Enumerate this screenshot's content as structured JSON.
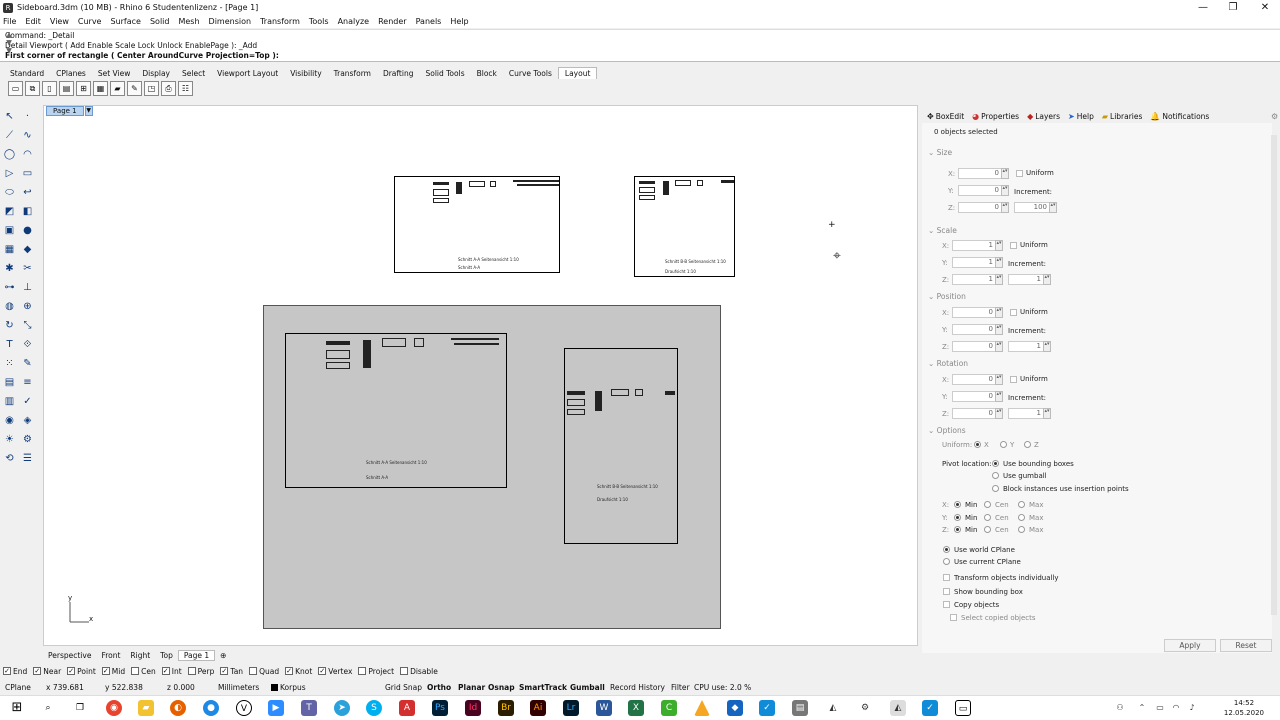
{
  "window": {
    "title": "Sideboard.3dm (10 MB) - Rhino 6 Studentenlizenz - [Page 1]",
    "app_icon": "rhino-icon",
    "minimize": "—",
    "maximize": "❐",
    "close": "✕"
  },
  "menu": [
    "File",
    "Edit",
    "View",
    "Curve",
    "Surface",
    "Solid",
    "Mesh",
    "Dimension",
    "Transform",
    "Tools",
    "Analyze",
    "Render",
    "Panels",
    "Help"
  ],
  "command": {
    "line1": "Command: _Detail",
    "line2": "Detail Viewport ( Add  Enable  Scale  Lock  Unlock  EnablePage ): _Add",
    "line3": "First corner of rectangle ( Center  AroundCurve  Projection=Top ):"
  },
  "toolbar_tabs": [
    "Standard",
    "CPlanes",
    "Set View",
    "Display",
    "Select",
    "Viewport Layout",
    "Visibility",
    "Transform",
    "Drafting",
    "Solid Tools",
    "Block",
    "Curve Tools",
    "Layout"
  ],
  "active_toolbar_tab": "Layout",
  "page_tab": {
    "label": "Page 1",
    "dropdown": "▼"
  },
  "axis": {
    "x": "x",
    "y": "y"
  },
  "detail_text": {
    "a1": "Schnitt A-A  Seitenansicht 1:10",
    "a2": "Schnitt A-A",
    "b1": "Schnitt B-B  Seitenansicht 1:10",
    "b2": "Draufsicht 1:10"
  },
  "view_tabs": [
    "Perspective",
    "Front",
    "Right",
    "Top",
    "Page 1"
  ],
  "view_tabs_add": "⊕",
  "osnaps": [
    {
      "label": "End",
      "checked": true
    },
    {
      "label": "Near",
      "checked": true
    },
    {
      "label": "Point",
      "checked": true
    },
    {
      "label": "Mid",
      "checked": true
    },
    {
      "label": "Cen",
      "checked": false
    },
    {
      "label": "Int",
      "checked": true
    },
    {
      "label": "Perp",
      "checked": false
    },
    {
      "label": "Tan",
      "checked": true
    },
    {
      "label": "Quad",
      "checked": false
    },
    {
      "label": "Knot",
      "checked": true
    },
    {
      "label": "Vertex",
      "checked": true
    },
    {
      "label": "Project",
      "checked": false
    },
    {
      "label": "Disable",
      "checked": false
    }
  ],
  "status": {
    "cplane": "CPlane",
    "x": "x 739.681",
    "y": "y 522.838",
    "z": "z 0.000",
    "units": "Millimeters",
    "layer": "Korpus",
    "layer_color": "#000000",
    "grid_snap": "Grid Snap",
    "ortho": "Ortho",
    "planar": "Planar",
    "osnap": "Osnap",
    "smarttrack": "SmartTrack",
    "gumball": "Gumball",
    "record_history": "Record History",
    "filter": "Filter",
    "cpu": "CPU use: 2.0 %"
  },
  "panel": {
    "tabs": [
      {
        "label": "BoxEdit",
        "icon": "boxedit-icon"
      },
      {
        "label": "Properties",
        "icon": "properties-icon"
      },
      {
        "label": "Layers",
        "icon": "layers-icon"
      },
      {
        "label": "Help",
        "icon": "help-icon"
      },
      {
        "label": "Libraries",
        "icon": "folder-icon"
      },
      {
        "label": "Notifications",
        "icon": "bell-icon"
      }
    ],
    "selected": "0 objects selected",
    "size": {
      "title": "Size",
      "x": "0",
      "y": "0",
      "z": "0",
      "uniform": "Uniform",
      "increment": "Increment:",
      "inc": "100"
    },
    "scale": {
      "title": "Scale",
      "x": "1",
      "y": "1",
      "z": "1",
      "uniform": "Uniform",
      "increment": "Increment:",
      "inc": "1"
    },
    "position": {
      "title": "Position",
      "x": "0",
      "y": "0",
      "z": "0",
      "uniform": "Uniform",
      "increment": "Increment:",
      "inc": "1"
    },
    "rotation": {
      "title": "Rotation",
      "x": "0",
      "y": "0",
      "z": "0",
      "uniform": "Uniform",
      "increment": "Increment:",
      "inc": "1"
    },
    "options": {
      "title": "Options",
      "uniform": "Uniform:",
      "ux": "X",
      "uy": "Y",
      "uz": "Z",
      "pivot": "Pivot location:",
      "p1": "Use bounding boxes",
      "p2": "Use gumball",
      "p3": "Block instances use insertion points",
      "min": "Min",
      "cen": "Cen",
      "max": "Max",
      "world": "Use world CPlane",
      "current": "Use current CPlane",
      "indiv": "Transform objects individually",
      "bbox": "Show bounding box",
      "copy": "Copy objects",
      "selcopy": "Select copied objects"
    },
    "apply": "Apply",
    "reset": "Reset"
  },
  "clock": {
    "time": "14:52",
    "date": "12.05.2020"
  }
}
